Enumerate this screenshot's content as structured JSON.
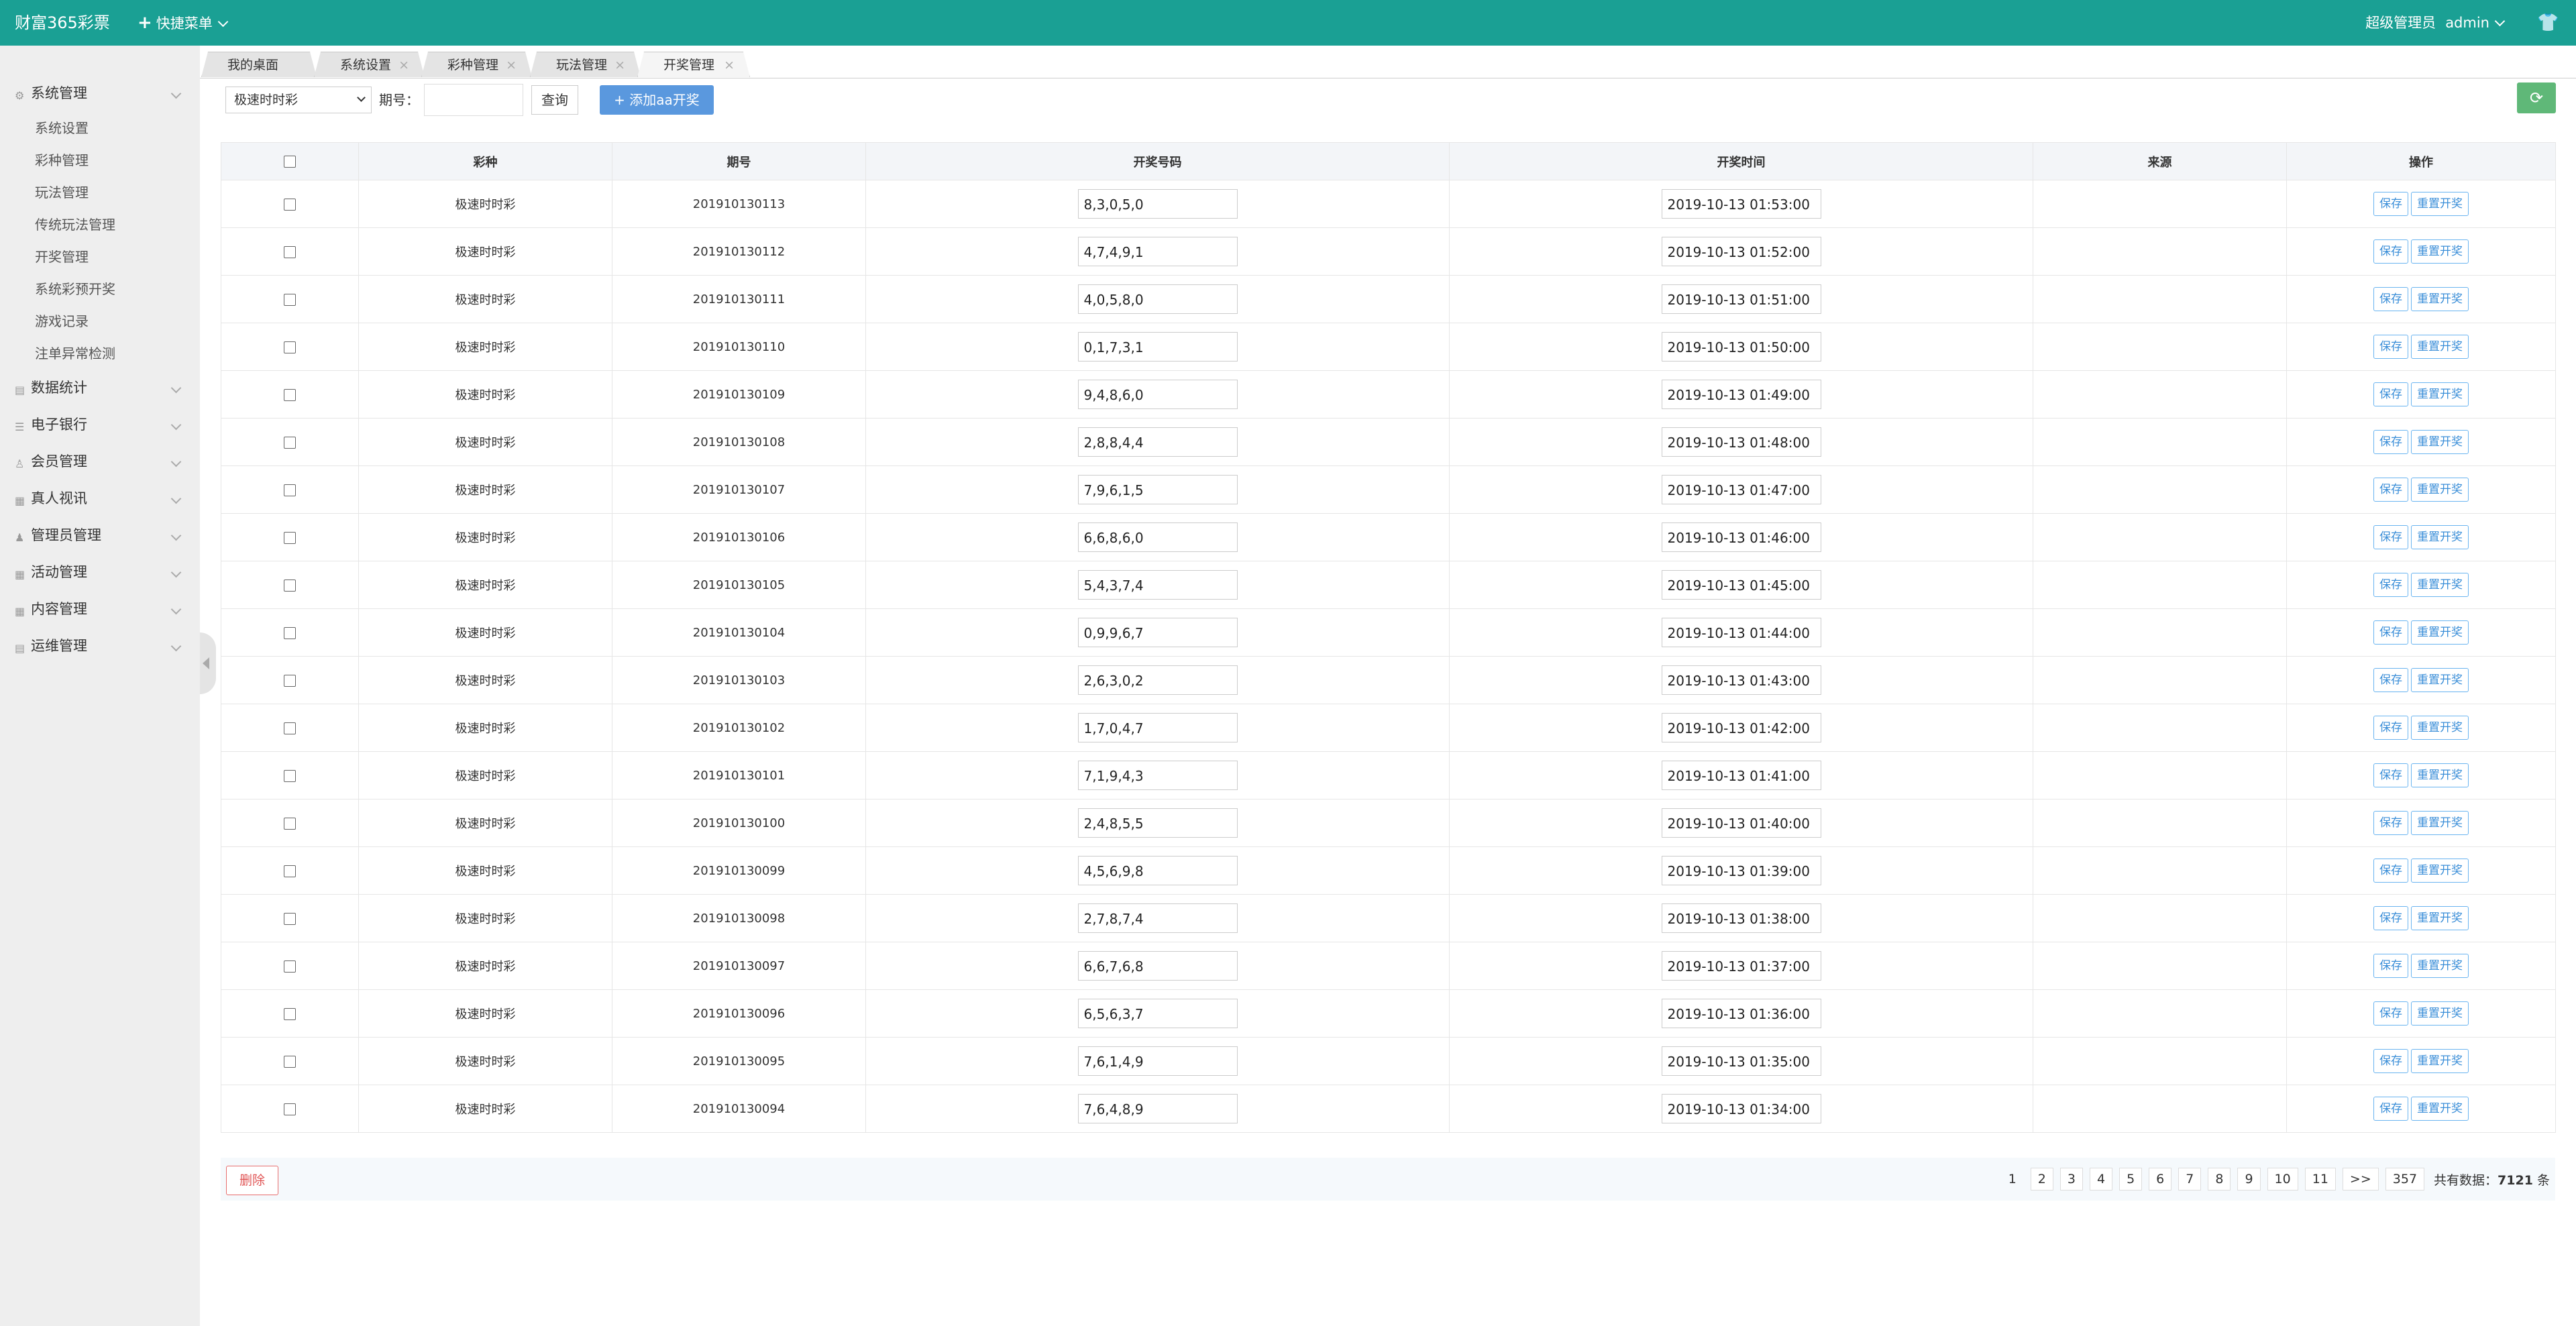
{
  "header": {
    "brand": "财富365彩票",
    "quick_menu": "快捷菜单",
    "role": "超级管理员",
    "user": "admin"
  },
  "sidebar": {
    "groups": [
      {
        "label": "系统管理",
        "items": [
          "系统设置",
          "彩种管理",
          "玩法管理",
          "传统玩法管理",
          "开奖管理",
          "系统彩预开奖",
          "游戏记录",
          "注单异常检测"
        ]
      },
      {
        "label": "数据统计"
      },
      {
        "label": "电子银行"
      },
      {
        "label": "会员管理"
      },
      {
        "label": "真人视讯"
      },
      {
        "label": "管理员管理"
      },
      {
        "label": "活动管理"
      },
      {
        "label": "内容管理"
      },
      {
        "label": "运维管理"
      }
    ]
  },
  "tabs": [
    {
      "label": "我的桌面"
    },
    {
      "label": "系统设置"
    },
    {
      "label": "彩种管理"
    },
    {
      "label": "玩法管理"
    },
    {
      "label": "开奖管理"
    }
  ],
  "toolbar": {
    "lottery_select": "极速时时彩",
    "issue_label": "期号：",
    "query_btn": "查询",
    "add_btn": "添加aa开奖"
  },
  "table": {
    "headers": [
      "彩种",
      "期号",
      "开奖号码",
      "开奖时间",
      "来源",
      "操作"
    ],
    "save_label": "保存",
    "reset_label": "重置开奖",
    "rows": [
      {
        "lottery": "极速时时彩",
        "issue": "201910130113",
        "numbers": "8,3,0,5,0",
        "time": "2019-10-13 01:53:00"
      },
      {
        "lottery": "极速时时彩",
        "issue": "201910130112",
        "numbers": "4,7,4,9,1",
        "time": "2019-10-13 01:52:00"
      },
      {
        "lottery": "极速时时彩",
        "issue": "201910130111",
        "numbers": "4,0,5,8,0",
        "time": "2019-10-13 01:51:00"
      },
      {
        "lottery": "极速时时彩",
        "issue": "201910130110",
        "numbers": "0,1,7,3,1",
        "time": "2019-10-13 01:50:00"
      },
      {
        "lottery": "极速时时彩",
        "issue": "201910130109",
        "numbers": "9,4,8,6,0",
        "time": "2019-10-13 01:49:00"
      },
      {
        "lottery": "极速时时彩",
        "issue": "201910130108",
        "numbers": "2,8,8,4,4",
        "time": "2019-10-13 01:48:00"
      },
      {
        "lottery": "极速时时彩",
        "issue": "201910130107",
        "numbers": "7,9,6,1,5",
        "time": "2019-10-13 01:47:00"
      },
      {
        "lottery": "极速时时彩",
        "issue": "201910130106",
        "numbers": "6,6,8,6,0",
        "time": "2019-10-13 01:46:00"
      },
      {
        "lottery": "极速时时彩",
        "issue": "201910130105",
        "numbers": "5,4,3,7,4",
        "time": "2019-10-13 01:45:00"
      },
      {
        "lottery": "极速时时彩",
        "issue": "201910130104",
        "numbers": "0,9,9,6,7",
        "time": "2019-10-13 01:44:00"
      },
      {
        "lottery": "极速时时彩",
        "issue": "201910130103",
        "numbers": "2,6,3,0,2",
        "time": "2019-10-13 01:43:00"
      },
      {
        "lottery": "极速时时彩",
        "issue": "201910130102",
        "numbers": "1,7,0,4,7",
        "time": "2019-10-13 01:42:00"
      },
      {
        "lottery": "极速时时彩",
        "issue": "201910130101",
        "numbers": "7,1,9,4,3",
        "time": "2019-10-13 01:41:00"
      },
      {
        "lottery": "极速时时彩",
        "issue": "201910130100",
        "numbers": "2,4,8,5,5",
        "time": "2019-10-13 01:40:00"
      },
      {
        "lottery": "极速时时彩",
        "issue": "201910130099",
        "numbers": "4,5,6,9,8",
        "time": "2019-10-13 01:39:00"
      },
      {
        "lottery": "极速时时彩",
        "issue": "201910130098",
        "numbers": "2,7,8,7,4",
        "time": "2019-10-13 01:38:00"
      },
      {
        "lottery": "极速时时彩",
        "issue": "201910130097",
        "numbers": "6,6,7,6,8",
        "time": "2019-10-13 01:37:00"
      },
      {
        "lottery": "极速时时彩",
        "issue": "201910130096",
        "numbers": "6,5,6,3,7",
        "time": "2019-10-13 01:36:00"
      },
      {
        "lottery": "极速时时彩",
        "issue": "201910130095",
        "numbers": "7,6,1,4,9",
        "time": "2019-10-13 01:35:00"
      },
      {
        "lottery": "极速时时彩",
        "issue": "201910130094",
        "numbers": "7,6,4,8,9",
        "time": "2019-10-13 01:34:00"
      }
    ]
  },
  "footer": {
    "delete_btn": "删除",
    "pages": [
      "1",
      "2",
      "3",
      "4",
      "5",
      "6",
      "7",
      "8",
      "9",
      "10",
      "11",
      ">>",
      "357"
    ],
    "total_prefix": "共有数据：",
    "total_count": "7121",
    "total_suffix": "条"
  },
  "colors": {
    "header_bg": "#1aa094",
    "add_btn": "#5a98de",
    "refresh_btn": "#5fb878",
    "delete_btn": "#e05555"
  }
}
